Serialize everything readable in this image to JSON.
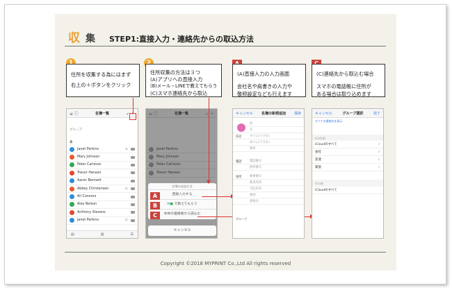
{
  "header": {
    "title_char1": "収",
    "title_char2": "集",
    "subtitle": "STEP1:直接入力・連絡先からの取込方法"
  },
  "footer": "Copyright ©2018 MYPRINT Co.,Ltd All rights reserved",
  "colors": {
    "accent": "#f0a832",
    "marker": "#c9443c",
    "highlight": "#dd3333",
    "slide_bg": "#f3f1e9"
  },
  "steps": [
    {
      "badge": "1",
      "lines": [
        "住所を収集する為にはまず",
        "右上の＋ボタンをクリック"
      ]
    },
    {
      "badge": "2",
      "lines": [
        "住所収集の方法は３つ",
        "(A)アプリへの直接入力",
        "(B)メール・LINEで教えてもらう",
        "(C)スマホ連絡先から取込"
      ]
    },
    {
      "badge": "A",
      "lines": [
        "(A)直接入力の入力画面",
        "会社名や肩書きの入力や",
        "敬称設定なども行えます"
      ]
    },
    {
      "badge": "C",
      "lines": [
        "(C)連絡先から取込む場合",
        "スマホの電話帳に住所が",
        "ある場合は取り込めます"
      ]
    }
  ],
  "phone1": {
    "nav_title": "名簿一覧",
    "group_label": "グループ",
    "section_letter": "あ",
    "contacts": [
      {
        "name": "Janet Perkins",
        "color": "#2b8dd8",
        "warn": true
      },
      {
        "name": "Mary Johnson",
        "color": "#e55a2b",
        "warn": false
      },
      {
        "name": "Peter Carlsson",
        "color": "#35a852",
        "warn": false
      },
      {
        "name": "Trevor Hansen",
        "color": "#e2462f",
        "warn": false
      },
      {
        "name": "Aaron Bennett",
        "color": "#2b8dd8",
        "warn": false
      },
      {
        "name": "Abbey Christensen",
        "color": "#e55a2b",
        "warn": true
      },
      {
        "name": "Ali Connors",
        "color": "#2b8dd8",
        "warn": false
      },
      {
        "name": "Alex Nelson",
        "color": "#35a852",
        "warn": false
      },
      {
        "name": "Anthony Stevens",
        "color": "#e2462f",
        "warn": false
      },
      {
        "name": "Janet Perkins",
        "color": "#2b8dd8",
        "warn": true
      }
    ]
  },
  "phone2": {
    "nav_title": "名簿一覧",
    "contacts": [
      "Janet Perkins",
      "Mary Johnson",
      "Peter Carlsson",
      "Trevor Hansen"
    ],
    "sheet_header": "名簿の追加方法",
    "options": [
      {
        "marker": "A",
        "label": "直接入力する"
      },
      {
        "marker": "B",
        "label": "で教えてもらう"
      },
      {
        "marker": "C",
        "label": "本体の連絡帳から読込む"
      }
    ],
    "cancel": "キャンセル"
  },
  "phone3": {
    "nav_left": "キャンセル",
    "nav_title": "名簿の新規追加",
    "nav_right": "保存",
    "name_label": "氏名",
    "tel_label": "電話",
    "addr_label": "住所",
    "fields_name": [
      "姓",
      "名",
      "せい(ふりがな)",
      "めい(ふりがな)",
      "敬称"
    ],
    "fields_tel": [
      "電話番号",
      "携帯番号"
    ],
    "fields_addr": [
      "郵便番号",
      "都道府県",
      "市区町村",
      "番地",
      "建物名"
    ],
    "group_label": "グループ"
  },
  "phone4": {
    "nav_left": "キャンセル",
    "nav_title": "グループ選択",
    "nav_right": "完了",
    "hint": "すべての連絡先を表示",
    "section1": "ICLOUD",
    "groups": [
      {
        "label": "iCloudのすべて",
        "checked": true
      },
      {
        "label": "会社",
        "checked": true
      },
      {
        "label": "友達",
        "checked": true
      },
      {
        "label": "家族",
        "checked": true
      }
    ],
    "section2": "その他",
    "other": "iCloudのすべて"
  }
}
